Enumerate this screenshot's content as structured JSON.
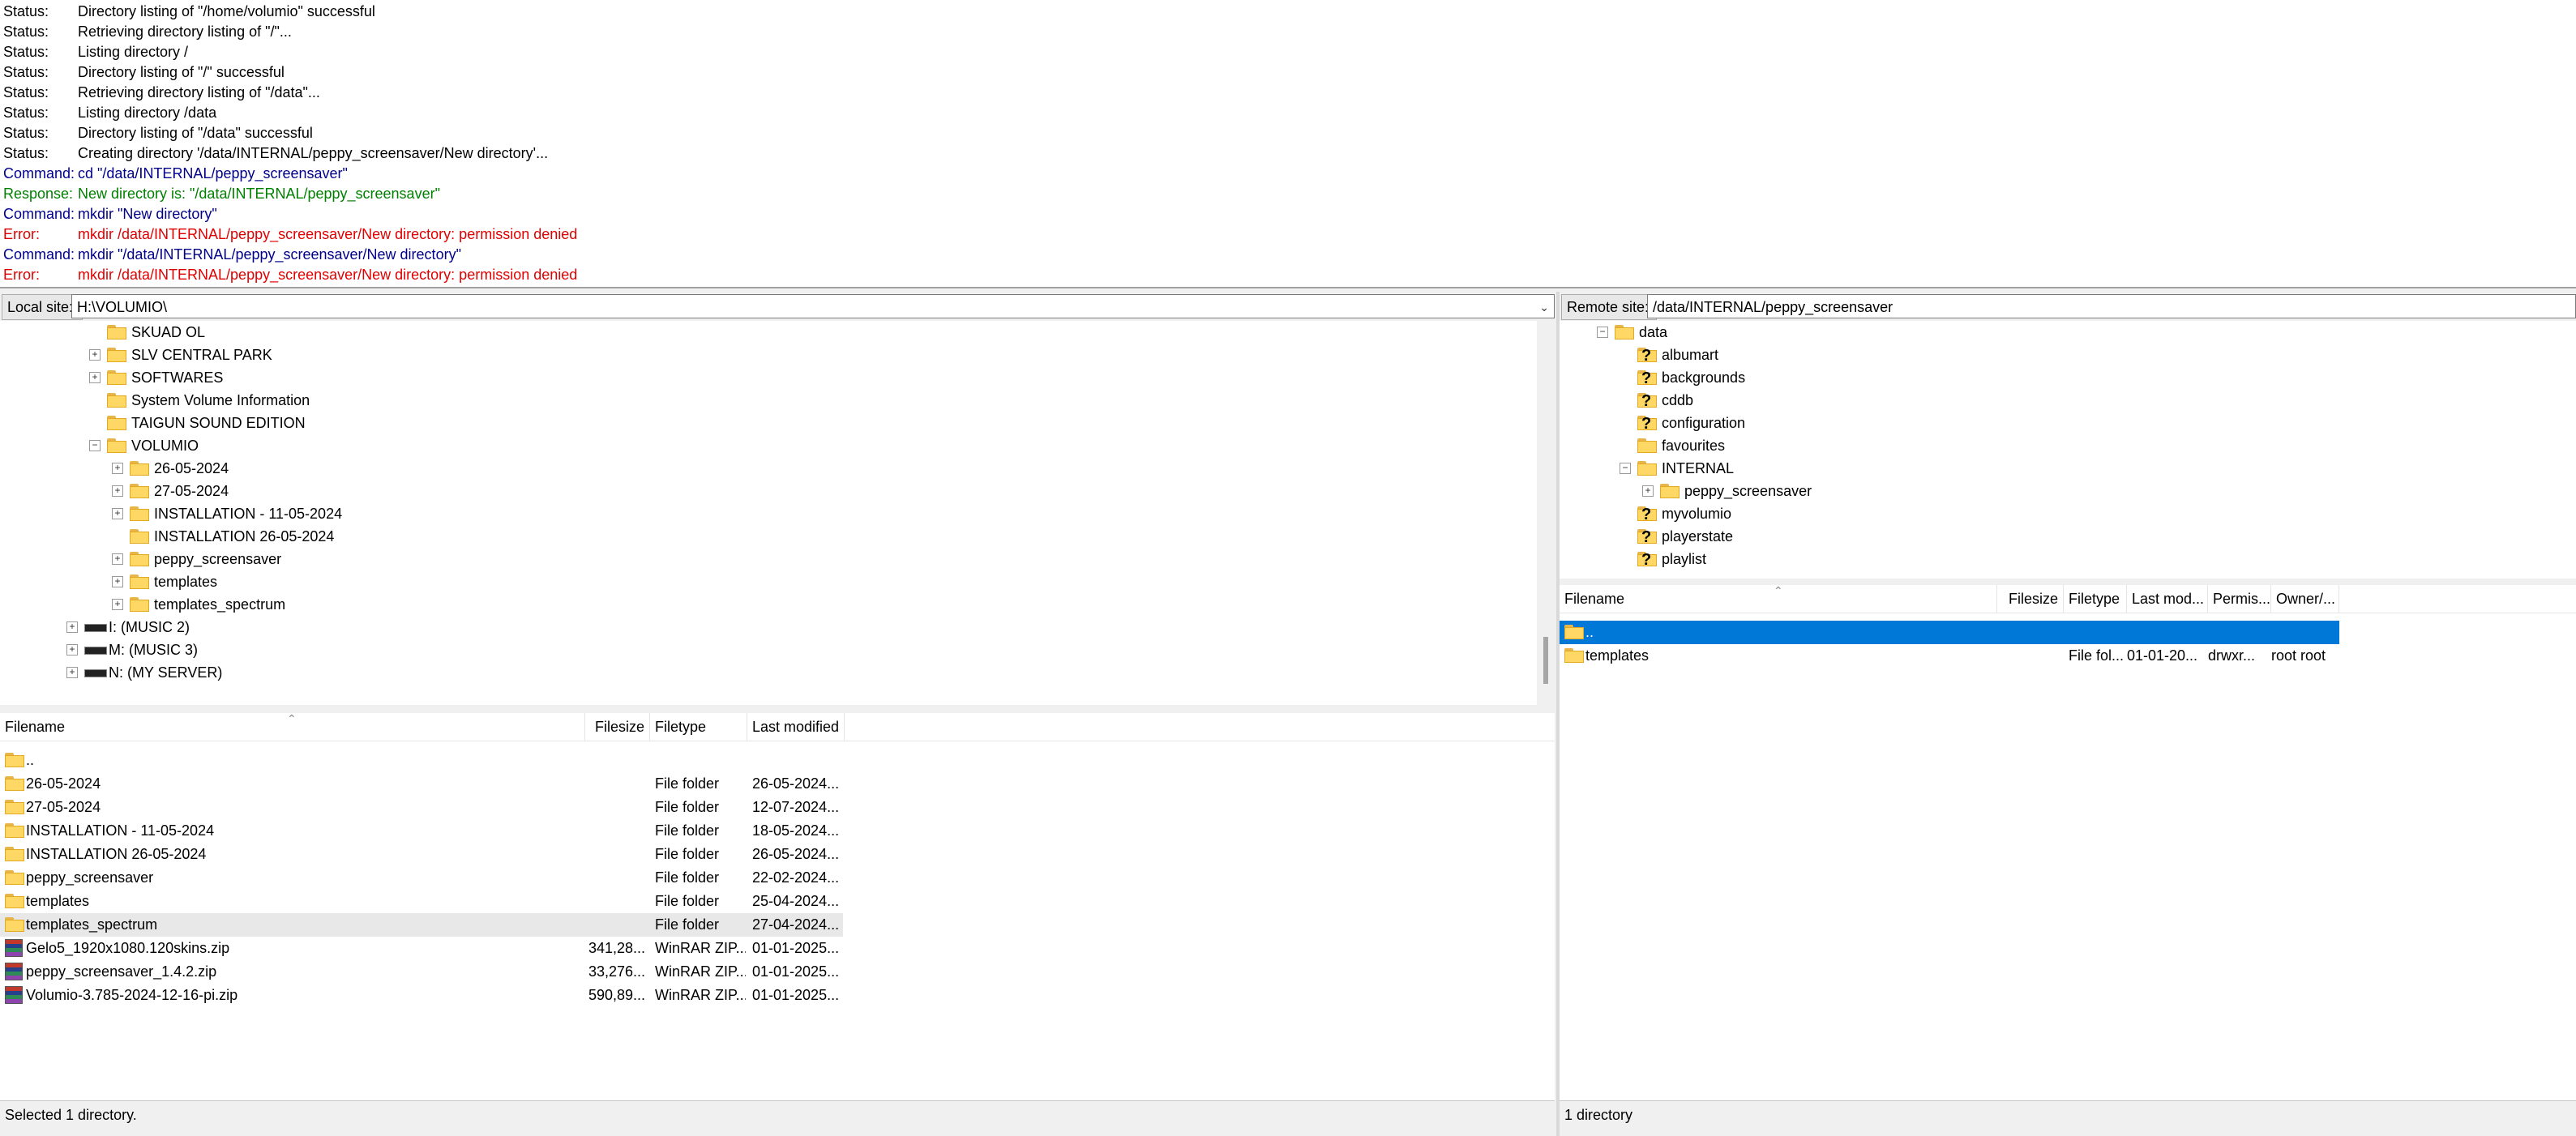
{
  "log": [
    {
      "label": "Status:",
      "text": "Directory listing of \"/home/volumio\" successful",
      "type": "status"
    },
    {
      "label": "Status:",
      "text": "Retrieving directory listing of \"/\"...",
      "type": "status"
    },
    {
      "label": "Status:",
      "text": "Listing directory /",
      "type": "status"
    },
    {
      "label": "Status:",
      "text": "Directory listing of \"/\" successful",
      "type": "status"
    },
    {
      "label": "Status:",
      "text": "Retrieving directory listing of \"/data\"...",
      "type": "status"
    },
    {
      "label": "Status:",
      "text": "Listing directory /data",
      "type": "status"
    },
    {
      "label": "Status:",
      "text": "Directory listing of \"/data\" successful",
      "type": "status"
    },
    {
      "label": "Status:",
      "text": "Creating directory '/data/INTERNAL/peppy_screensaver/New directory'...",
      "type": "status"
    },
    {
      "label": "Command:",
      "text": "cd \"/data/INTERNAL/peppy_screensaver\"",
      "type": "command"
    },
    {
      "label": "Response:",
      "text": "New directory is: \"/data/INTERNAL/peppy_screensaver\"",
      "type": "response"
    },
    {
      "label": "Command:",
      "text": "mkdir \"New directory\"",
      "type": "command"
    },
    {
      "label": "Error:",
      "text": "mkdir /data/INTERNAL/peppy_screensaver/New directory: permission denied",
      "type": "error"
    },
    {
      "label": "Command:",
      "text": "mkdir \"/data/INTERNAL/peppy_screensaver/New directory\"",
      "type": "command"
    },
    {
      "label": "Error:",
      "text": "mkdir /data/INTERNAL/peppy_screensaver/New directory: permission denied",
      "type": "error"
    }
  ],
  "local": {
    "site_label": "Local site:",
    "site_path": "H:\\VOLUMIO\\",
    "tree": [
      {
        "label": "SKUAD OL",
        "level": 3,
        "expander": "",
        "kind": "folder"
      },
      {
        "label": "SLV CENTRAL PARK",
        "level": 3,
        "expander": "+",
        "kind": "folder"
      },
      {
        "label": "SOFTWARES",
        "level": 3,
        "expander": "+",
        "kind": "folder"
      },
      {
        "label": "System Volume Information",
        "level": 3,
        "expander": "",
        "kind": "folder"
      },
      {
        "label": "TAIGUN SOUND EDITION",
        "level": 3,
        "expander": "",
        "kind": "folder"
      },
      {
        "label": "VOLUMIO",
        "level": 3,
        "expander": "-",
        "kind": "folder"
      },
      {
        "label": "26-05-2024",
        "level": 4,
        "expander": "+",
        "kind": "folder"
      },
      {
        "label": "27-05-2024",
        "level": 4,
        "expander": "+",
        "kind": "folder"
      },
      {
        "label": "INSTALLATION - 11-05-2024",
        "level": 4,
        "expander": "+",
        "kind": "folder"
      },
      {
        "label": "INSTALLATION 26-05-2024",
        "level": 4,
        "expander": "",
        "kind": "folder"
      },
      {
        "label": "peppy_screensaver",
        "level": 4,
        "expander": "+",
        "kind": "folder"
      },
      {
        "label": "templates",
        "level": 4,
        "expander": "+",
        "kind": "folder"
      },
      {
        "label": "templates_spectrum",
        "level": 4,
        "expander": "+",
        "kind": "folder"
      },
      {
        "label": "I: (MUSIC 2)",
        "level": 2,
        "expander": "+",
        "kind": "drive"
      },
      {
        "label": "M: (MUSIC 3)",
        "level": 2,
        "expander": "+",
        "kind": "drive"
      },
      {
        "label": "N: (MY SERVER)",
        "level": 2,
        "expander": "+",
        "kind": "drive"
      }
    ],
    "columns": {
      "filename": "Filename",
      "filesize": "Filesize",
      "filetype": "Filetype",
      "modified": "Last modified"
    },
    "files": [
      {
        "name": "..",
        "size": "",
        "type": "",
        "modified": "",
        "icon": "folder"
      },
      {
        "name": "26-05-2024",
        "size": "",
        "type": "File folder",
        "modified": "26-05-2024...",
        "icon": "folder"
      },
      {
        "name": "27-05-2024",
        "size": "",
        "type": "File folder",
        "modified": "12-07-2024...",
        "icon": "folder"
      },
      {
        "name": "INSTALLATION - 11-05-2024",
        "size": "",
        "type": "File folder",
        "modified": "18-05-2024...",
        "icon": "folder"
      },
      {
        "name": "INSTALLATION 26-05-2024",
        "size": "",
        "type": "File folder",
        "modified": "26-05-2024...",
        "icon": "folder"
      },
      {
        "name": "peppy_screensaver",
        "size": "",
        "type": "File folder",
        "modified": "22-02-2024...",
        "icon": "folder"
      },
      {
        "name": "templates",
        "size": "",
        "type": "File folder",
        "modified": "25-04-2024...",
        "icon": "folder"
      },
      {
        "name": "templates_spectrum",
        "size": "",
        "type": "File folder",
        "modified": "27-04-2024...",
        "icon": "folder"
      },
      {
        "name": "Gelo5_1920x1080.120skins.zip",
        "size": "341,28...",
        "type": "WinRAR ZIP...",
        "modified": "01-01-2025...",
        "icon": "zip"
      },
      {
        "name": "peppy_screensaver_1.4.2.zip",
        "size": "33,276...",
        "type": "WinRAR ZIP...",
        "modified": "01-01-2025...",
        "icon": "zip"
      },
      {
        "name": "Volumio-3.785-2024-12-16-pi.zip",
        "size": "590,89...",
        "type": "WinRAR ZIP...",
        "modified": "01-01-2025...",
        "icon": "zip"
      }
    ],
    "status": "Selected 1 directory."
  },
  "remote": {
    "site_label": "Remote site:",
    "site_path": "/data/INTERNAL/peppy_screensaver",
    "tree": [
      {
        "label": "data",
        "level": 1,
        "expander": "-",
        "kind": "folder"
      },
      {
        "label": "albumart",
        "level": 2,
        "expander": "",
        "kind": "qfolder"
      },
      {
        "label": "backgrounds",
        "level": 2,
        "expander": "",
        "kind": "qfolder"
      },
      {
        "label": "cddb",
        "level": 2,
        "expander": "",
        "kind": "qfolder"
      },
      {
        "label": "configuration",
        "level": 2,
        "expander": "",
        "kind": "qfolder"
      },
      {
        "label": "favourites",
        "level": 2,
        "expander": "",
        "kind": "folder"
      },
      {
        "label": "INTERNAL",
        "level": 2,
        "expander": "-",
        "kind": "folder"
      },
      {
        "label": "peppy_screensaver",
        "level": 3,
        "expander": "+",
        "kind": "folder"
      },
      {
        "label": "myvolumio",
        "level": 2,
        "expander": "",
        "kind": "qfolder"
      },
      {
        "label": "playerstate",
        "level": 2,
        "expander": "",
        "kind": "qfolder"
      },
      {
        "label": "playlist",
        "level": 2,
        "expander": "",
        "kind": "qfolder"
      }
    ],
    "columns": {
      "filename": "Filename",
      "filesize": "Filesize",
      "filetype": "Filetype",
      "modified": "Last mod...",
      "perms": "Permis...",
      "owner": "Owner/..."
    },
    "files": [
      {
        "name": "..",
        "size": "",
        "type": "",
        "modified": "",
        "perms": "",
        "owner": "",
        "selected": true
      },
      {
        "name": "templates",
        "size": "",
        "type": "File fol...",
        "modified": "01-01-20...",
        "perms": "drwxr...",
        "owner": "root root",
        "selected": false
      }
    ],
    "status": "1 directory"
  },
  "colors": {
    "selection": "#0078d7",
    "status": "#000000",
    "command": "#00008b",
    "response": "#008000",
    "error": "#e00000"
  }
}
